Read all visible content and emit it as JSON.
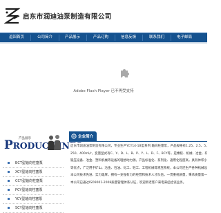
{
  "header": {
    "company_name": "启东市润迪油泵制造有限公司",
    "logo_text": "RD"
  },
  "nav": {
    "items": [
      {
        "label": "返回首页"
      },
      {
        "label": "公司简介"
      },
      {
        "label": "产品展示"
      },
      {
        "label": "产品订购"
      },
      {
        "label": "信息反馈"
      },
      {
        "label": "联系我们"
      },
      {
        "label": "电子邮局"
      }
    ]
  },
  "flash": {
    "message": "Adobe Flash Player 已不再受支持",
    "icon": "puzzle-piece-icon"
  },
  "sidebar": {
    "banner_cn": "产品展示",
    "banner_en": "RODUCT INFO",
    "banner_en_first": "P",
    "products": [
      {
        "label": "BCT型轴向柱塞泵"
      },
      {
        "label": "XCY型轴向柱塞泵"
      },
      {
        "label": "CCY型轴向柱塞泵"
      },
      {
        "label": "PCY型轴向柱塞泵"
      },
      {
        "label": "YCY型轴向柱塞泵"
      },
      {
        "label": "SCY型轴向柱塞泵"
      }
    ]
  },
  "about": {
    "title": "企业简介",
    "lines": [
      "启东市润迪油泵制造有限公司，专业生产YCY14-1B型系列 轴向柱塞泵，产品规格有1.25、2.5、5、10、25、40、63、80、160、",
      "250、400ml/r，变量型式有C、Y、D、L、B、P、Y、L、D、F、BCY等，是橡胶、机械、冶金、矿山、船舶、工程机械、起重运输机械",
      "锻压设备、冶金、塑料机械等设备的理想动力源。产品标准化、系列化、通用化程度高，具有体积小、重量轻、自吸性能好、效率高、寿命长",
      "等优点，广泛用于矿山、冶金、石油、化工、轻工、工程机械等液压系统，本公司还生产各种机械设备。",
      "本公司技术先进、实力雄厚，拥有一支强有力的经营和技术人才队伍，一贯重视质量，秉承质量第一、用户至上的宗旨，竭诚为用户服务。",
      "本公司已通过ISO9001-2008质量管理体系认证，欢迎新老客户来电来函洽谈业务。"
    ]
  },
  "colors": {
    "nav_bg": "#15528f",
    "title_blue": "#14347a"
  }
}
